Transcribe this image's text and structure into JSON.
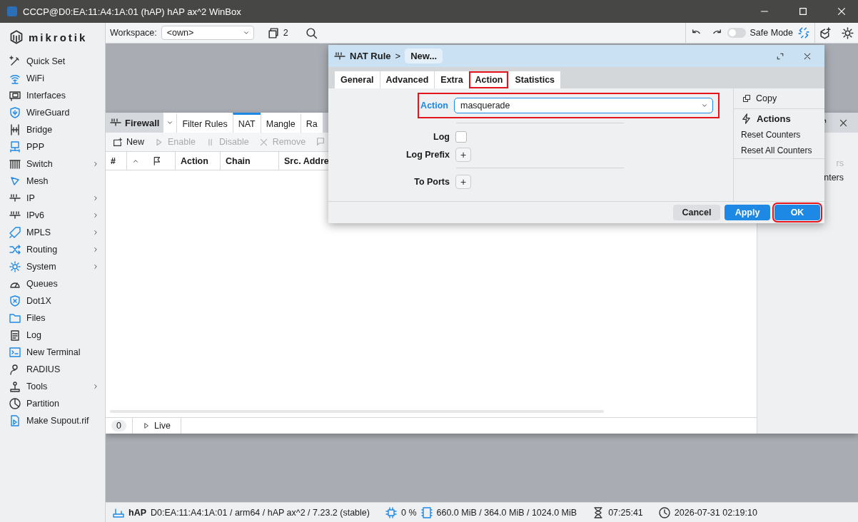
{
  "window": {
    "title": "CCCP@D0:EA:11:A4:1A:01 (hAP) hAP ax^2 WinBox"
  },
  "logo": {
    "text": "mikrotik"
  },
  "sidebar": {
    "items": [
      {
        "label": "Quick Set",
        "submenu": false
      },
      {
        "label": "WiFi",
        "submenu": false
      },
      {
        "label": "Interfaces",
        "submenu": false
      },
      {
        "label": "WireGuard",
        "submenu": false
      },
      {
        "label": "Bridge",
        "submenu": false
      },
      {
        "label": "PPP",
        "submenu": false
      },
      {
        "label": "Switch",
        "submenu": true
      },
      {
        "label": "Mesh",
        "submenu": false
      },
      {
        "label": "IP",
        "submenu": true
      },
      {
        "label": "IPv6",
        "submenu": true
      },
      {
        "label": "MPLS",
        "submenu": true
      },
      {
        "label": "Routing",
        "submenu": true
      },
      {
        "label": "System",
        "submenu": true
      },
      {
        "label": "Queues",
        "submenu": false
      },
      {
        "label": "Dot1X",
        "submenu": false
      },
      {
        "label": "Files",
        "submenu": false
      },
      {
        "label": "Log",
        "submenu": false
      },
      {
        "label": "New Terminal",
        "submenu": false
      },
      {
        "label": "RADIUS",
        "submenu": false
      },
      {
        "label": "Tools",
        "submenu": true
      },
      {
        "label": "Partition",
        "submenu": false
      },
      {
        "label": "Make Supout.rif",
        "submenu": false
      }
    ]
  },
  "toolbar": {
    "workspace_label": "Workspace:",
    "workspace_value": "<own>",
    "window_count": "2",
    "safe_mode": {
      "label": "Safe Mode",
      "on": false
    }
  },
  "firewall": {
    "title": "Firewall",
    "tabs": [
      {
        "label": "Filter Rules",
        "selected": false
      },
      {
        "label": "NAT",
        "selected": true
      },
      {
        "label": "Mangle",
        "selected": false
      },
      {
        "label": "Ra",
        "selected": false
      }
    ],
    "actions": [
      {
        "label": "New",
        "disabled": false
      },
      {
        "label": "Enable",
        "disabled": true
      },
      {
        "label": "Disable",
        "disabled": true
      },
      {
        "label": "Remove",
        "disabled": true
      }
    ],
    "columns": [
      "#",
      "Action",
      "Chain",
      "Src. Addre"
    ],
    "side_texts": [
      {
        "text": "rs",
        "disabled": true
      },
      {
        "text": "nters",
        "disabled": false
      }
    ],
    "row_count": "0",
    "live_label": "Live"
  },
  "dialog": {
    "title": "NAT Rule",
    "crumb": ">",
    "subtitle": "New...",
    "tabs": [
      {
        "label": "General",
        "highlighted": false
      },
      {
        "label": "Advanced",
        "highlighted": false
      },
      {
        "label": "Extra",
        "highlighted": false
      },
      {
        "label": "Action",
        "highlighted": true
      },
      {
        "label": "Statistics",
        "highlighted": false
      }
    ],
    "fields": [
      {
        "kind": "select",
        "label": "Action",
        "value": "masquerade",
        "focused": true,
        "highlighted": true
      },
      {
        "kind": "divider"
      },
      {
        "kind": "checkbox",
        "label": "Log",
        "checked": false
      },
      {
        "kind": "add",
        "label": "Log Prefix",
        "button": "+"
      },
      {
        "kind": "divider"
      },
      {
        "kind": "add",
        "label": "To Ports",
        "button": "+"
      }
    ],
    "side": {
      "copy": "Copy",
      "actions_title": "Actions",
      "actions": [
        "Reset Counters",
        "Reset All Counters"
      ]
    },
    "buttons": [
      {
        "label": "Cancel",
        "kind": "secondary",
        "highlighted": false
      },
      {
        "label": "Apply",
        "kind": "primary",
        "highlighted": false
      },
      {
        "label": "OK",
        "kind": "primary",
        "highlighted": true
      }
    ]
  },
  "status_bar": {
    "device": "hAP",
    "details": "D0:EA:11:A4:1A:01 / arm64 / hAP ax^2 / 7.23.2 (stable)",
    "cpu": "0 %",
    "memory": "660.0 MiB / 364.0 MiB / 1024.0 MiB",
    "uptime": "07:25:41",
    "datetime": "2026-07-31 02:19:10"
  }
}
